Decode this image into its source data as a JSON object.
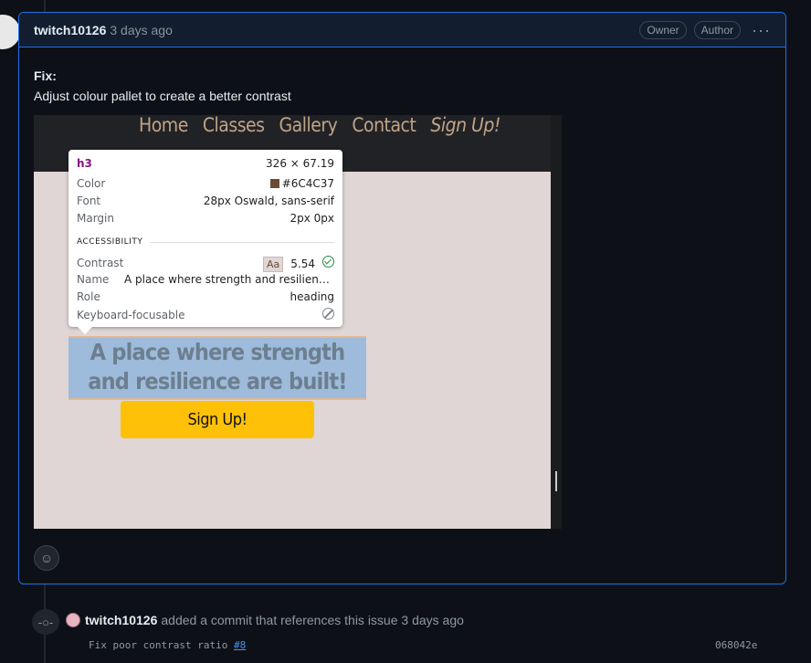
{
  "comment": {
    "author": "twitch10126",
    "time": "3 days ago",
    "badges": [
      "Owner",
      "Author"
    ],
    "more_icon": "kebab-horizontal-icon",
    "body_title": "Fix:",
    "body_text": "Adjust colour pallet to create a better contrast",
    "reaction_icon": "smiley-icon"
  },
  "screenshot": {
    "nav": [
      "Home",
      "Classes",
      "Gallery",
      "Contact",
      "Sign Up!"
    ],
    "heading": "A place where strength and resilience are built!",
    "cta_label": "Sign Up!",
    "colors": {
      "nav_bg": "#212226",
      "nav_text": "#bfa486",
      "page_bg": "#e0d6d6",
      "highlight": "#9fbbdb",
      "cta": "#ffc107"
    },
    "inspector": {
      "tag": "h3",
      "size": "326 × 67.19",
      "color_label": "Color",
      "color_value": "#6C4C37",
      "font_label": "Font",
      "font_value": "28px Oswald, sans-serif",
      "margin_label": "Margin",
      "margin_value": "2px 0px",
      "section": "ACCESSIBILITY",
      "contrast_label": "Contrast",
      "contrast_sample": "Aa",
      "contrast_value": "5.54",
      "name_label": "Name",
      "name_value": "A place where strength and resilience a…",
      "role_label": "Role",
      "role_value": "heading",
      "keyboard_label": "Keyboard-focusable"
    }
  },
  "event": {
    "icon": "git-commit-icon",
    "author": "twitch10126",
    "text": "added a commit that references this issue 3 days ago",
    "commit_message": "Fix poor contrast ratio",
    "issue_ref": "#8",
    "sha": "068042e"
  }
}
